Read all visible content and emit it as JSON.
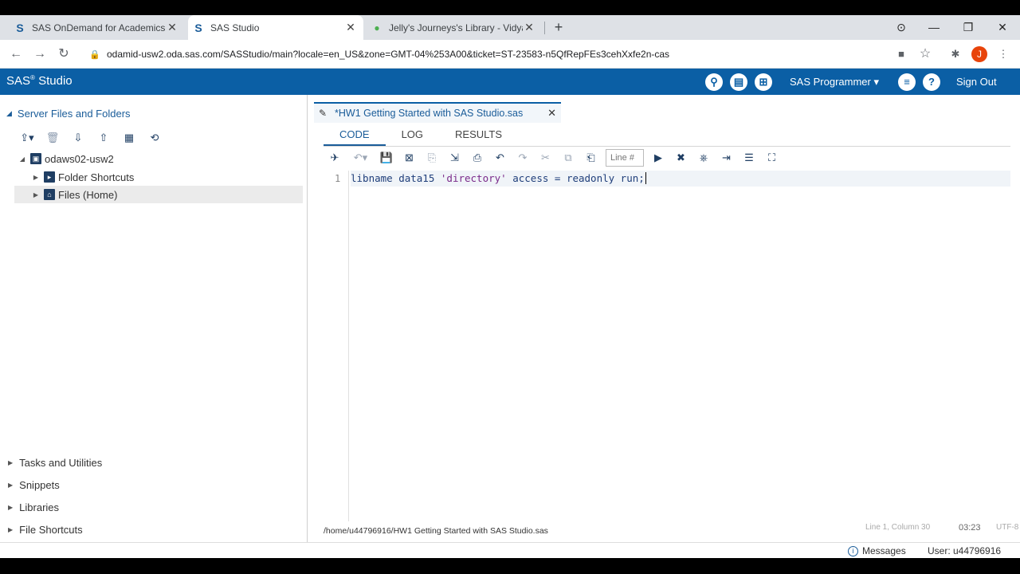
{
  "browser": {
    "tabs": [
      {
        "favicon": "S",
        "title": "SAS OnDemand for Academics",
        "close": "✕"
      },
      {
        "favicon": "S",
        "title": "SAS Studio",
        "close": "✕"
      },
      {
        "favicon": "●",
        "title": "Jelly's Journeys's Library - Vidyar",
        "close": "✕"
      }
    ],
    "new_tab": "+",
    "window_controls": {
      "menu": "⊙",
      "minimize": "—",
      "restore": "❐",
      "close": "✕"
    },
    "nav": {
      "back": "←",
      "forward": "→",
      "reload": "↻"
    },
    "url": "odamid-usw2.oda.sas.com/SASStudio/main?locale=en_US&zone=GMT-04%253A00&ticket=ST-23583-n5QfRepFEs3cehXxfe2n-cas",
    "lock": "🔒",
    "extensions": {
      "camera": "■",
      "star": "☆",
      "puzzle": "✱"
    },
    "profile_initial": "J"
  },
  "sas_header": {
    "logo": "SAS",
    "logo_super": "®",
    "logo_suffix": " Studio",
    "icons": {
      "search": "⚲",
      "print": "▤",
      "apps": "⊞",
      "menu": "≡",
      "help": "?"
    },
    "perspective": "SAS Programmer ▾",
    "sign_out": "Sign Out"
  },
  "left_nav": {
    "section_title": "Server Files and Folders",
    "section_arrow": "◢",
    "tools": {
      "new": "⇪▾",
      "delete": "🗑",
      "download": "⇩",
      "upload": "⇧",
      "properties": "▦",
      "refresh": "⟲"
    },
    "tree": {
      "server": "odaws02-usw2",
      "folder_shortcuts": "Folder Shortcuts",
      "files_home": "Files (Home)"
    },
    "tree_arrows": {
      "expanded": "◢",
      "collapsed": "▶"
    },
    "accordions": [
      "Tasks and Utilities",
      "Snippets",
      "Libraries",
      "File Shortcuts"
    ],
    "accordion_arrow": "▶"
  },
  "editor": {
    "file_tab": "*HW1 Getting Started with SAS Studio.sas",
    "file_close": "✕",
    "subtabs": [
      "CODE",
      "LOG",
      "RESULTS"
    ],
    "active_subtab": "CODE",
    "tools": {
      "run": "✈",
      "history": "↶▾",
      "save": "💾",
      "save_as": "⊠",
      "new_process": "⎘",
      "export": "⇲",
      "print": "⎙",
      "undo": "↶",
      "redo": "↷",
      "cut": "✂",
      "copy": "⧉",
      "paste": "⎗",
      "go_to": "▶",
      "clear": "✖",
      "find": "⎈",
      "format": "⇥",
      "edit_menu": "☰",
      "maximize": "⛶"
    },
    "line_placeholder": "Line #",
    "code": {
      "line_number": "1",
      "kw_libname": "libname data15 ",
      "str": "'directory'",
      "rest": " access = readonly run;"
    },
    "status_path": "/home/u44796916/HW1 Getting Started with SAS Studio.sas",
    "status_position": "Line 1, Column 30",
    "status_time": "03:23",
    "status_extra": "UTF-8"
  },
  "bottom_bar": {
    "messages": "Messages",
    "info_icon": "i",
    "user": "User: u44796916"
  }
}
